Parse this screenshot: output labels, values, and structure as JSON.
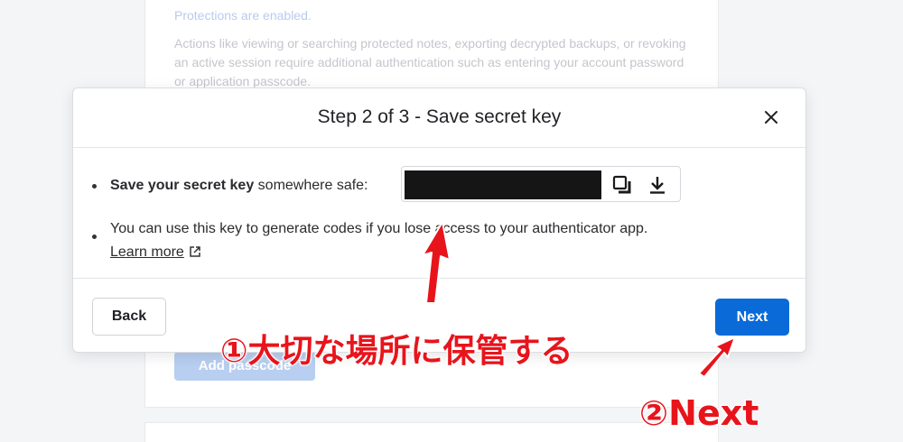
{
  "background": {
    "protections_status": "Protections are enabled.",
    "protections_description": "Actions like viewing or searching protected notes, exporting decrypted backups, or revoking an active session require additional authentication such as entering your account password or application passcode.",
    "add_passcode_label": "Add passcode"
  },
  "modal": {
    "title": "Step 2 of 3 - Save secret key",
    "close_icon": "close-icon",
    "bullet1_bold": "Save your secret key",
    "bullet1_rest": " somewhere safe:",
    "copy_icon": "copy-icon",
    "download_icon": "download-icon",
    "bullet2_text": "You can use this key to generate codes if you lose access to your authenticator app.",
    "learn_more_label": "Learn more",
    "back_label": "Back",
    "next_label": "Next"
  },
  "annotations": {
    "note1": "①大切な場所に保管する",
    "note2": "②Next",
    "color": "#e8141c"
  },
  "colors": {
    "primary_button": "#0a6ad8",
    "background": "#f4f5f7"
  }
}
